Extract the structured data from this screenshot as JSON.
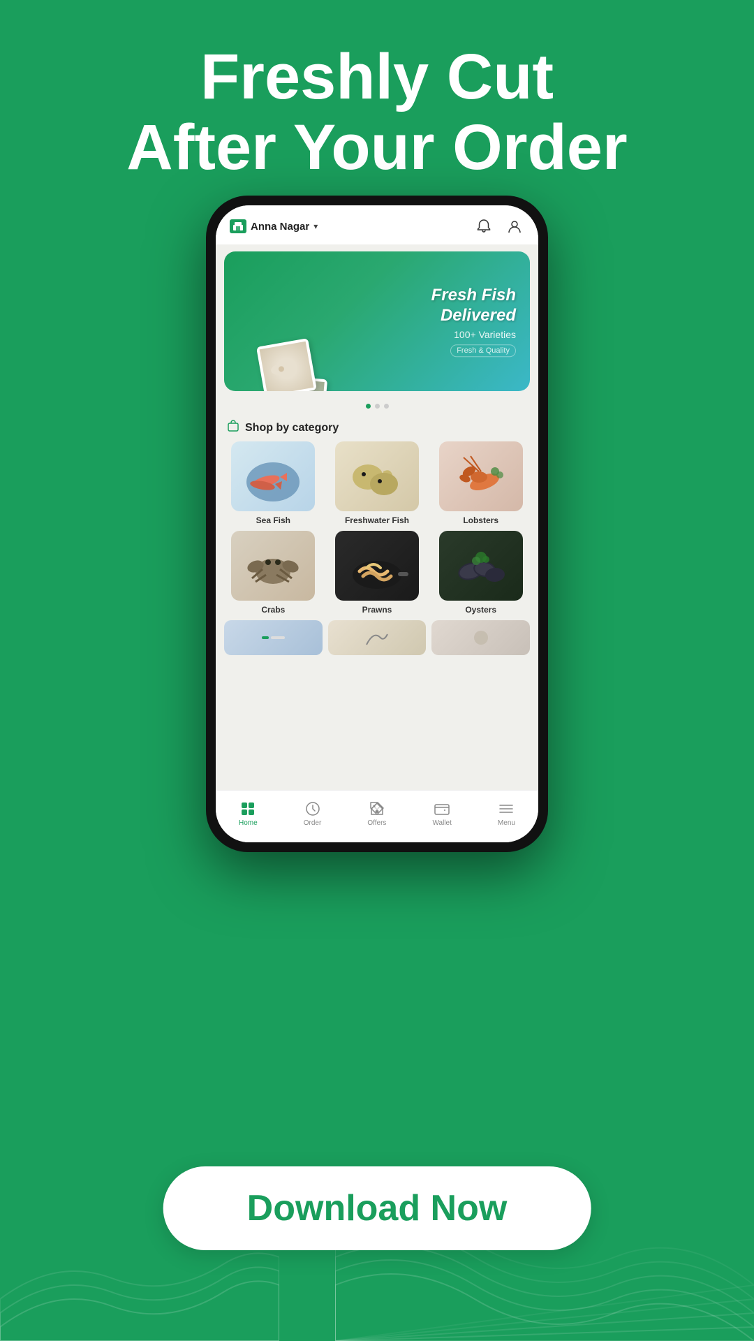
{
  "headline": {
    "line1": "Freshly Cut",
    "line2": "After Your Order"
  },
  "topbar": {
    "location": "Anna Nagar",
    "chevron": "▾"
  },
  "banner": {
    "title": "Fresh Fish\nDelivered",
    "subtitle": "100+ Varieties",
    "tagline": "Fresh & Quality"
  },
  "dots": [
    {
      "active": true
    },
    {
      "active": false
    },
    {
      "active": false
    }
  ],
  "section": {
    "title": "Shop by category"
  },
  "categories": [
    {
      "name": "Sea Fish",
      "emoji": "🐟"
    },
    {
      "name": "Freshwater Fish",
      "emoji": "🐠"
    },
    {
      "name": "Lobsters",
      "emoji": "🦞"
    },
    {
      "name": "Crabs",
      "emoji": "🦀"
    },
    {
      "name": "Prawns",
      "emoji": "🍤"
    },
    {
      "name": "Oysters",
      "emoji": "🦪"
    }
  ],
  "bottom_nav": [
    {
      "label": "Home",
      "icon": "⊞",
      "active": true
    },
    {
      "label": "Order",
      "icon": "⏱",
      "active": false
    },
    {
      "label": "Offers",
      "icon": "🏷",
      "active": false
    },
    {
      "label": "Wallet",
      "icon": "💳",
      "active": false
    },
    {
      "label": "Menu",
      "icon": "☰",
      "active": false
    }
  ],
  "download_button": {
    "label": "Download Now"
  }
}
